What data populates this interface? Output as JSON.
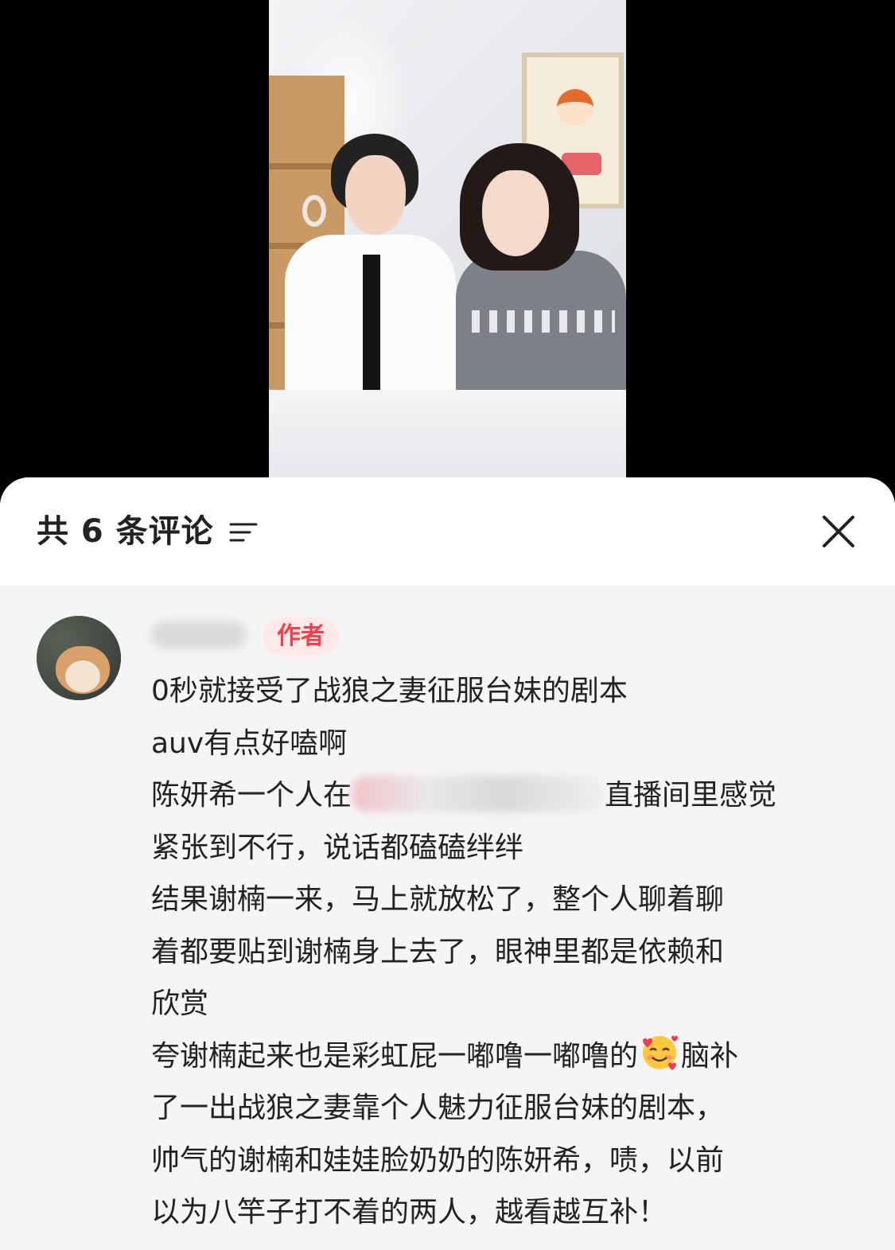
{
  "panel": {
    "title": "共 6 条评论",
    "sort_icon": "sort-icon",
    "close_icon": "close-icon"
  },
  "comment": {
    "avatar_icon": "dog-avatar",
    "badge": "作者",
    "lines": [
      "0秒就接受了战狼之妻征服台妹的剧本",
      "auv有点好嗑啊",
      {
        "before": "陈妍希一个人在",
        "after": "直播间里感觉"
      },
      "紧张到不行，说话都磕磕绊绊",
      "结果谢楠一来，马上就放松了，整个人聊着聊",
      "着都要贴到谢楠身上去了，眼神里都是依赖和",
      "欣赏",
      {
        "before": "夸谢楠起来也是彩虹屁一嘟噜一嘟噜的",
        "emoji": "smiling-face-with-hearts",
        "after": "脑补"
      },
      "了一出战狼之妻靠个人魅力征服台妹的剧本，",
      "帅气的谢楠和娃娃脸奶奶的陈妍希，啧，以前",
      "以为八竿子打不着的两人，越看越互补！"
    ]
  },
  "colors": {
    "badge_bg": "#ffe8e8",
    "badge_text": "#f2404b",
    "panel_bg": "#f5f5f7",
    "text": "#222222"
  }
}
